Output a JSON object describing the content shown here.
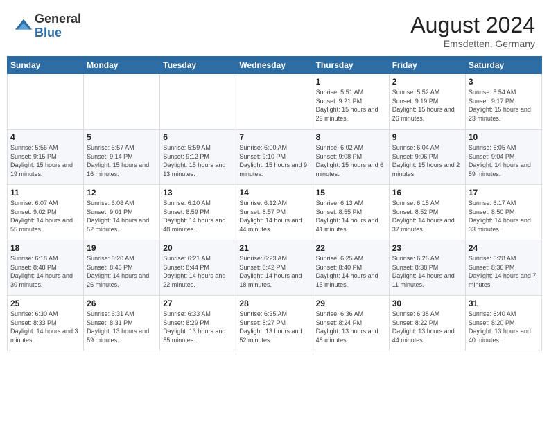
{
  "header": {
    "logo_general": "General",
    "logo_blue": "Blue",
    "month_title": "August 2024",
    "location": "Emsdetten, Germany"
  },
  "weekdays": [
    "Sunday",
    "Monday",
    "Tuesday",
    "Wednesday",
    "Thursday",
    "Friday",
    "Saturday"
  ],
  "weeks": [
    [
      {
        "day": "",
        "info": ""
      },
      {
        "day": "",
        "info": ""
      },
      {
        "day": "",
        "info": ""
      },
      {
        "day": "",
        "info": ""
      },
      {
        "day": "1",
        "info": "Sunrise: 5:51 AM\nSunset: 9:21 PM\nDaylight: 15 hours\nand 29 minutes."
      },
      {
        "day": "2",
        "info": "Sunrise: 5:52 AM\nSunset: 9:19 PM\nDaylight: 15 hours\nand 26 minutes."
      },
      {
        "day": "3",
        "info": "Sunrise: 5:54 AM\nSunset: 9:17 PM\nDaylight: 15 hours\nand 23 minutes."
      }
    ],
    [
      {
        "day": "4",
        "info": "Sunrise: 5:56 AM\nSunset: 9:15 PM\nDaylight: 15 hours\nand 19 minutes."
      },
      {
        "day": "5",
        "info": "Sunrise: 5:57 AM\nSunset: 9:14 PM\nDaylight: 15 hours\nand 16 minutes."
      },
      {
        "day": "6",
        "info": "Sunrise: 5:59 AM\nSunset: 9:12 PM\nDaylight: 15 hours\nand 13 minutes."
      },
      {
        "day": "7",
        "info": "Sunrise: 6:00 AM\nSunset: 9:10 PM\nDaylight: 15 hours\nand 9 minutes."
      },
      {
        "day": "8",
        "info": "Sunrise: 6:02 AM\nSunset: 9:08 PM\nDaylight: 15 hours\nand 6 minutes."
      },
      {
        "day": "9",
        "info": "Sunrise: 6:04 AM\nSunset: 9:06 PM\nDaylight: 15 hours\nand 2 minutes."
      },
      {
        "day": "10",
        "info": "Sunrise: 6:05 AM\nSunset: 9:04 PM\nDaylight: 14 hours\nand 59 minutes."
      }
    ],
    [
      {
        "day": "11",
        "info": "Sunrise: 6:07 AM\nSunset: 9:02 PM\nDaylight: 14 hours\nand 55 minutes."
      },
      {
        "day": "12",
        "info": "Sunrise: 6:08 AM\nSunset: 9:01 PM\nDaylight: 14 hours\nand 52 minutes."
      },
      {
        "day": "13",
        "info": "Sunrise: 6:10 AM\nSunset: 8:59 PM\nDaylight: 14 hours\nand 48 minutes."
      },
      {
        "day": "14",
        "info": "Sunrise: 6:12 AM\nSunset: 8:57 PM\nDaylight: 14 hours\nand 44 minutes."
      },
      {
        "day": "15",
        "info": "Sunrise: 6:13 AM\nSunset: 8:55 PM\nDaylight: 14 hours\nand 41 minutes."
      },
      {
        "day": "16",
        "info": "Sunrise: 6:15 AM\nSunset: 8:52 PM\nDaylight: 14 hours\nand 37 minutes."
      },
      {
        "day": "17",
        "info": "Sunrise: 6:17 AM\nSunset: 8:50 PM\nDaylight: 14 hours\nand 33 minutes."
      }
    ],
    [
      {
        "day": "18",
        "info": "Sunrise: 6:18 AM\nSunset: 8:48 PM\nDaylight: 14 hours\nand 30 minutes."
      },
      {
        "day": "19",
        "info": "Sunrise: 6:20 AM\nSunset: 8:46 PM\nDaylight: 14 hours\nand 26 minutes."
      },
      {
        "day": "20",
        "info": "Sunrise: 6:21 AM\nSunset: 8:44 PM\nDaylight: 14 hours\nand 22 minutes."
      },
      {
        "day": "21",
        "info": "Sunrise: 6:23 AM\nSunset: 8:42 PM\nDaylight: 14 hours\nand 18 minutes."
      },
      {
        "day": "22",
        "info": "Sunrise: 6:25 AM\nSunset: 8:40 PM\nDaylight: 14 hours\nand 15 minutes."
      },
      {
        "day": "23",
        "info": "Sunrise: 6:26 AM\nSunset: 8:38 PM\nDaylight: 14 hours\nand 11 minutes."
      },
      {
        "day": "24",
        "info": "Sunrise: 6:28 AM\nSunset: 8:36 PM\nDaylight: 14 hours\nand 7 minutes."
      }
    ],
    [
      {
        "day": "25",
        "info": "Sunrise: 6:30 AM\nSunset: 8:33 PM\nDaylight: 14 hours\nand 3 minutes."
      },
      {
        "day": "26",
        "info": "Sunrise: 6:31 AM\nSunset: 8:31 PM\nDaylight: 13 hours\nand 59 minutes."
      },
      {
        "day": "27",
        "info": "Sunrise: 6:33 AM\nSunset: 8:29 PM\nDaylight: 13 hours\nand 55 minutes."
      },
      {
        "day": "28",
        "info": "Sunrise: 6:35 AM\nSunset: 8:27 PM\nDaylight: 13 hours\nand 52 minutes."
      },
      {
        "day": "29",
        "info": "Sunrise: 6:36 AM\nSunset: 8:24 PM\nDaylight: 13 hours\nand 48 minutes."
      },
      {
        "day": "30",
        "info": "Sunrise: 6:38 AM\nSunset: 8:22 PM\nDaylight: 13 hours\nand 44 minutes."
      },
      {
        "day": "31",
        "info": "Sunrise: 6:40 AM\nSunset: 8:20 PM\nDaylight: 13 hours\nand 40 minutes."
      }
    ]
  ]
}
